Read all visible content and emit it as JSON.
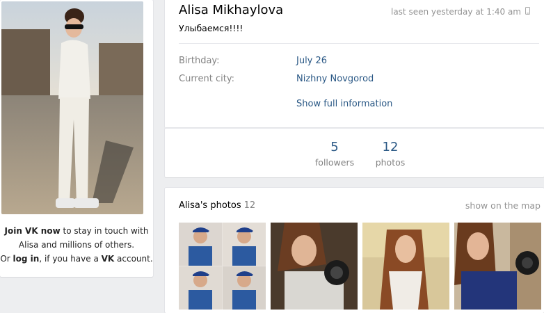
{
  "profile": {
    "name": "Alisa Mikhaylova",
    "last_seen": "last seen yesterday at 1:40 am",
    "status": "Улыбаемся!!!!",
    "birthday_label": "Birthday:",
    "birthday_value": "July 26",
    "city_label": "Current city:",
    "city_value": "Nizhny Novgorod",
    "show_full": "Show full information"
  },
  "counts": [
    {
      "num": "5",
      "caption": "followers"
    },
    {
      "num": "12",
      "caption": "photos"
    }
  ],
  "join": {
    "join_link": "Join VK now",
    "text1": " to stay in touch with Alisa and millions of others.",
    "or": "Or ",
    "login_link": "log in",
    "text2": ", if you have a ",
    "vk": "VK",
    "text3": " account."
  },
  "photos": {
    "title": "Alisa's photos",
    "count": "12",
    "show_map": "show on the map"
  },
  "colors": {
    "link": "#2a5885",
    "muted": "#828282",
    "background": "#edeef0"
  }
}
